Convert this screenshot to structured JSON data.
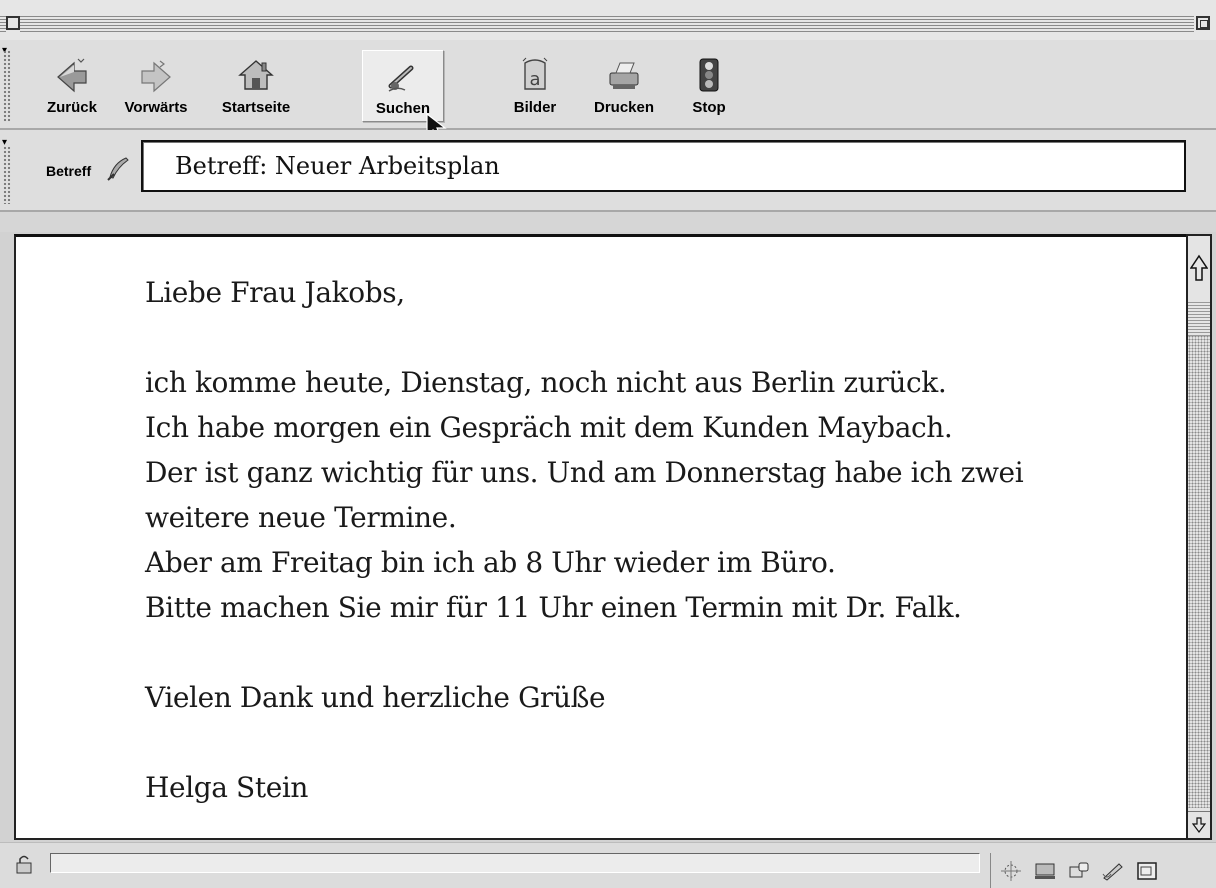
{
  "toolbar": {
    "items": [
      {
        "label": "Zurück",
        "icon": "back-arrow-icon"
      },
      {
        "label": "Vorwärts",
        "icon": "forward-arrow-icon"
      },
      {
        "label": "Startseite",
        "icon": "home-icon"
      },
      {
        "label": "Suchen",
        "icon": "search-icon",
        "active": true
      },
      {
        "label": "Bilder",
        "icon": "images-icon"
      },
      {
        "label": "Drucken",
        "icon": "printer-icon"
      },
      {
        "label": "Stop",
        "icon": "traffic-light-icon"
      }
    ]
  },
  "subject": {
    "label": "Betreff",
    "icon": "quill-icon",
    "value": "Betreff: Neuer Arbeitsplan"
  },
  "message": {
    "lines": [
      "Liebe Frau Jakobs,",
      "",
      "ich komme heute, Dienstag, noch nicht aus Berlin zurück.",
      "Ich habe morgen ein Gespräch mit dem Kunden Maybach.",
      "Der ist ganz wichtig für uns. Und am Donnerstag habe ich zwei",
      "weitere neue Termine.",
      "Aber am Freitag bin ich ab 8 Uhr wieder im Büro.",
      "Bitte machen Sie mir für 11 Uhr einen Termin mit Dr. Falk.",
      "",
      "Vielen Dank und herzliche Grüße",
      "",
      "Helga Stein"
    ]
  },
  "statusbar": {
    "icons": [
      "lock-icon",
      "network-icon",
      "computer-icon",
      "mail-icon",
      "compose-icon",
      "window-icon"
    ]
  }
}
